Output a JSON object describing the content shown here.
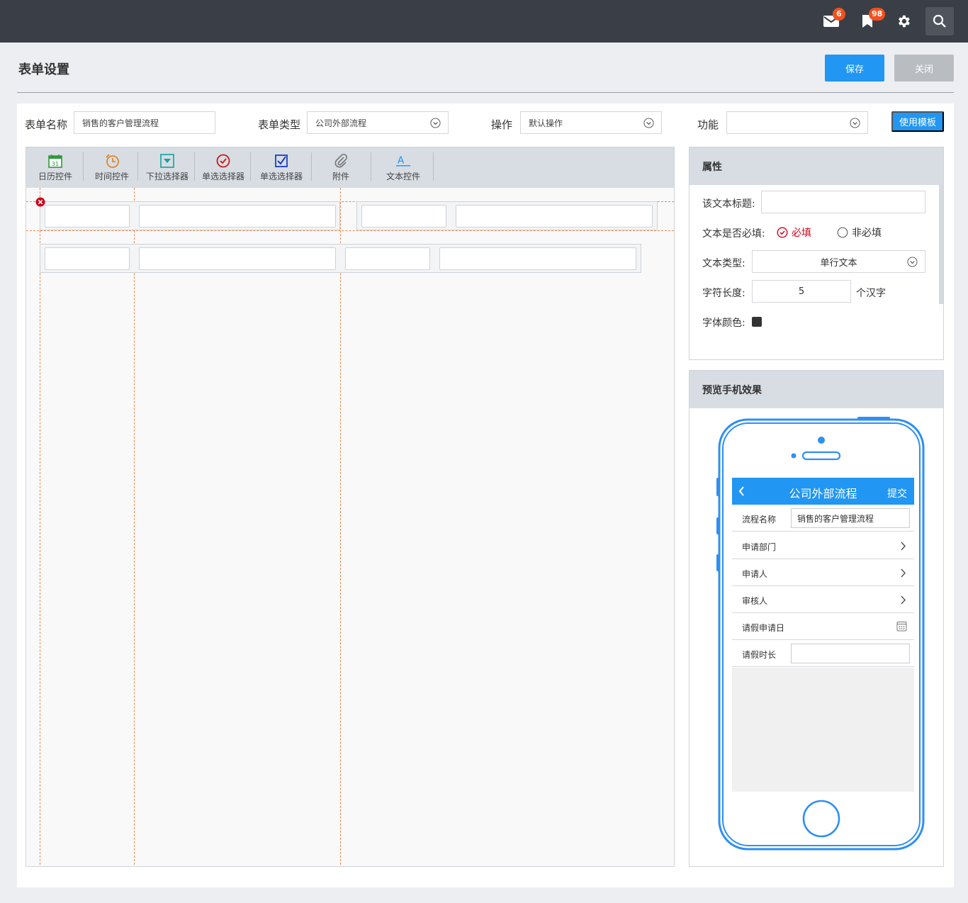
{
  "topbar": {
    "mail_icon": "mail-icon",
    "mail_badge": "6",
    "bookmark_icon": "bookmark-icon",
    "bookmark_badge": "98",
    "settings_icon": "gear-icon",
    "search_icon": "search-icon"
  },
  "page": {
    "title": "表单设置",
    "save_label": "保存",
    "close_label": "关闭"
  },
  "form": {
    "name_label": "表单名称",
    "name_value": "销售的客户管理流程",
    "type_label": "表单类型",
    "type_value": "公司外部流程",
    "op_label": "操作",
    "op_value": "默认操作",
    "func_label": "功能",
    "func_value": "",
    "template_button": "使用模板"
  },
  "toolbar": {
    "items": [
      {
        "label": "日历控件",
        "icon": "calendar-icon"
      },
      {
        "label": "时间控件",
        "icon": "alarm-clock-icon"
      },
      {
        "label": "下拉选择器",
        "icon": "dropdown-icon"
      },
      {
        "label": "单选选择器",
        "icon": "radio-check-icon"
      },
      {
        "label": "单选选择器",
        "icon": "checkbox-icon"
      },
      {
        "label": "附件",
        "icon": "paperclip-icon"
      },
      {
        "label": "文本控件",
        "icon": "text-icon"
      }
    ],
    "calendar_day": "31",
    "text_glyph": "A"
  },
  "properties": {
    "title": "属性",
    "text_title_label": "该文本标题:",
    "text_title_value": "",
    "required_label": "文本是否必填:",
    "required_option": "必填",
    "optional_option": "非必填",
    "required_selected": true,
    "text_type_label": "文本类型:",
    "text_type_value": "单行文本",
    "length_label": "字符长度:",
    "length_value": "5",
    "length_unit": "个汉字",
    "font_color_label": "字体颜色:",
    "font_color": "#333333"
  },
  "preview": {
    "title": "预览手机效果",
    "phone": {
      "header_title": "公司外部流程",
      "submit_label": "提交",
      "rows": [
        {
          "label": "流程名称",
          "value": "销售的客户管理流程",
          "kind": "input"
        },
        {
          "label": "申请部门",
          "kind": "arrow"
        },
        {
          "label": "申请人",
          "kind": "arrow"
        },
        {
          "label": "审核人",
          "kind": "arrow"
        },
        {
          "label": "请假申请日",
          "kind": "calendar"
        },
        {
          "label": "请假时长",
          "value": "",
          "kind": "input"
        }
      ]
    }
  },
  "colors": {
    "accent": "#2196f3",
    "topbar": "#3a3f47",
    "badge": "#f4511e",
    "guide": "#f08a4b",
    "required": "#d0021b"
  }
}
